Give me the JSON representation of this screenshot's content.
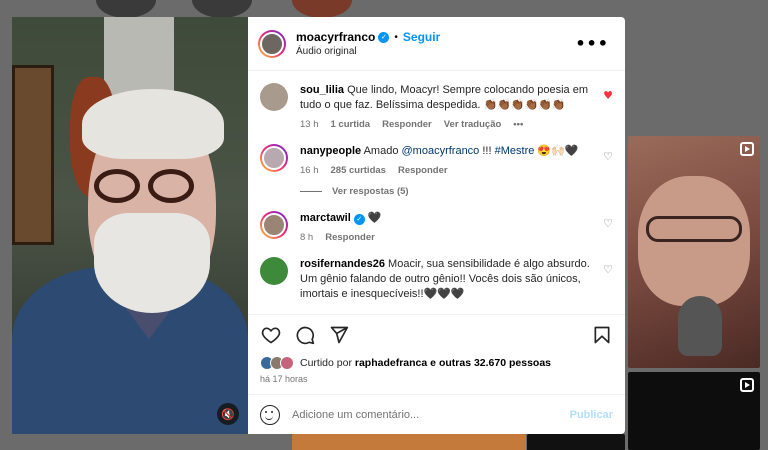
{
  "post": {
    "username": "moacyrfranco",
    "verified": true,
    "separator": "•",
    "follow_label": "Seguir",
    "audio_label": "Áudio original",
    "more_label": "•••"
  },
  "comments": [
    {
      "username": "sou_lilia",
      "text": "Que lindo, Moacyr! Sempre colocando poesia em tudo o que faz. Belíssima despedida. 👏🏾👏🏾👏🏾👏🏾👏🏾👏🏾",
      "time": "13 h",
      "likes": "1 curtida",
      "reply": "Responder",
      "translate": "Ver tradução",
      "options": "•••",
      "liked": true
    },
    {
      "username": "nanypeople",
      "text_prefix": "Amado",
      "mention": "@moacyrfranco",
      "text_mid": "!!!",
      "hashtag": "#Mestre",
      "text_suffix": "😍🙌🏻🖤",
      "time": "16 h",
      "likes": "285 curtidas",
      "reply": "Responder",
      "liked": false
    },
    {
      "username": "marctawil",
      "text": "🖤",
      "time": "8 h",
      "reply": "Responder",
      "liked": false
    },
    {
      "username": "rosifernandes26",
      "text": "Moacir, sua sensibilidade é algo absurdo. Um gênio falando de outro gênio!! Vocês dois são únicos, imortais e inesquecíveis!!🖤🖤🖤",
      "liked": false
    }
  ],
  "view_replies": "Ver respostas (5)",
  "likes": {
    "prefix": "Curtido por",
    "user": "raphadefranca",
    "middle": "e",
    "others": "outras 32.670 pessoas"
  },
  "posted_ago": "há 17 horas",
  "add_comment": {
    "placeholder": "Adicione um comentário...",
    "publish_label": "Publicar"
  },
  "colors": {
    "accent": "#0095f6",
    "liked_heart": "#ff3040",
    "publish_disabled": "#b2dffc"
  }
}
